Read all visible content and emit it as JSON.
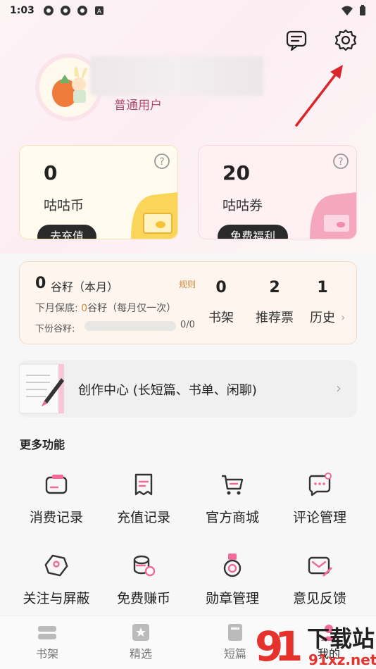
{
  "status_bar": {
    "time": "1:03"
  },
  "profile": {
    "user_type": "普通用户"
  },
  "wallet": [
    {
      "value": "0",
      "label": "咕咕币",
      "action": "去充值"
    },
    {
      "value": "20",
      "label": "咕咕券",
      "action": "免费福利"
    }
  ],
  "seeds": {
    "count": "0",
    "title_suffix": "谷籽（本月）",
    "rule": "规则",
    "line1_prefix": "下月保底: ",
    "line1_value": "0",
    "line1_suffix": "谷籽（每月仅一次）",
    "line2_label": "下份谷籽:",
    "progress_text": "0/0",
    "progress": 0
  },
  "stats": [
    {
      "value": "0",
      "label": "书架"
    },
    {
      "value": "2",
      "label": "推荐票"
    },
    {
      "value": "1",
      "label": "历史"
    }
  ],
  "creator": {
    "label": "创作中心 (长短篇、书单、闲聊)"
  },
  "more": {
    "title": "更多功能",
    "items": [
      {
        "label": "消费记录",
        "icon": "wallet-icon"
      },
      {
        "label": "充值记录",
        "icon": "receipt-icon"
      },
      {
        "label": "官方商城",
        "icon": "cart-icon"
      },
      {
        "label": "评论管理",
        "icon": "comment-icon"
      },
      {
        "label": "关注与屏蔽",
        "icon": "tag-icon"
      },
      {
        "label": "免费赚币",
        "icon": "coins-icon"
      },
      {
        "label": "勋章管理",
        "icon": "medal-icon"
      },
      {
        "label": "意见反馈",
        "icon": "feedback-icon"
      }
    ]
  },
  "tabs": [
    {
      "label": "书架"
    },
    {
      "label": "精选"
    },
    {
      "label": "短篇"
    },
    {
      "label": "我的"
    }
  ],
  "watermark": {
    "text": "下载站",
    "url_text": "91xz.net"
  },
  "colors": {
    "accent": "#e65a86",
    "dark_pill": "#2a2a2a",
    "seed_orange": "#d08a3a"
  }
}
